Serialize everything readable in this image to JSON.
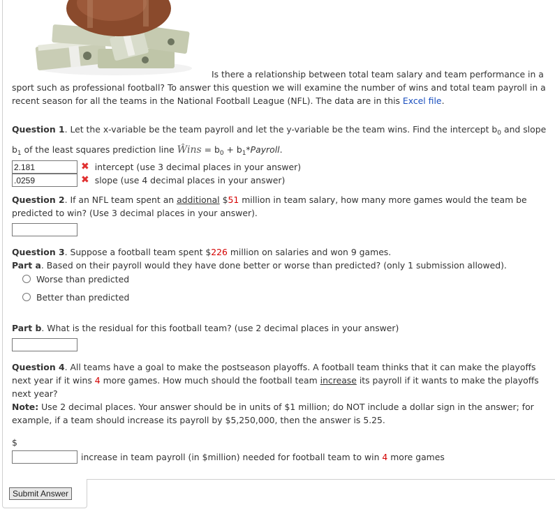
{
  "hero_image": {
    "alt": "football on stacks of dollar bills"
  },
  "intro": {
    "text": "Is there a relationship between total team salary and team performance in a sport such as professional football? To answer this question we will examine the number of wins and total team payroll in a recent season for all the teams in the National Football League (NFL). The data are in this ",
    "link_text": "Excel file",
    "end": "."
  },
  "q1": {
    "label": "Question 1",
    "text_a": ". Let the x-variable be the team payroll and let the y-variable be the team wins. Find the intercept b",
    "sub0": "0",
    "text_b": " and slope",
    "text_c": "b",
    "sub1": "1",
    "text_d": " of the least squares prediction line ",
    "wins_hat": "Ŵins",
    "text_e": " = b",
    "text_f": " + b",
    "text_g": "*",
    "payroll": "Payroll",
    "text_h": ".",
    "intercept_value": "2.181",
    "intercept_label": "intercept (use 3 decimal places in your answer)",
    "slope_value": ".0259",
    "slope_label": "slope (use 4 decimal places in your answer)",
    "status_icon": "✖"
  },
  "q2": {
    "label": "Question 2",
    "text_a": ". If an NFL team spent an ",
    "underlined": "additional",
    "text_b": " $",
    "amount": "51",
    "text_c": " million in team salary, how many more games would the team be predicted to win? (Use 3 decimal places in your answer).",
    "value": ""
  },
  "q3": {
    "label": "Question 3",
    "text_a": ". Suppose a football team spent $",
    "amount": "226",
    "text_b": " million on salaries and won 9 games.",
    "part_a_label": "Part a",
    "part_a_text": ". Based on their payroll would they have done better or worse than predicted? (only 1 submission allowed).",
    "options": [
      "Worse than predicted",
      "Better than predicted"
    ],
    "part_b_label": "Part b",
    "part_b_text": ". What is the residual for this football team? (use 2 decimal places in your answer)",
    "residual_value": ""
  },
  "q4": {
    "label": "Question 4",
    "text_a": ". All teams have a goal to make the postseason playoffs. A football team thinks that it can make the playoffs next year if it wins ",
    "wins": "4",
    "text_b": " more games. How much should the football team ",
    "underlined": "increase",
    "text_c": " its payroll if it wants to make the playoffs next year?",
    "note_label": "Note:",
    "note_text": " Use 2 decimal places. Your answer should be in units of $1 million; do NOT include a dollar sign in the answer; for example, if a team should increase its payroll by $5,250,000, then the answer is 5.25.",
    "dollar": "$",
    "value": "",
    "answer_label_a": "increase in team payroll (in $million) needed for football team to win ",
    "answer_label_b": " more games"
  },
  "submit_label": "Submit Answer"
}
